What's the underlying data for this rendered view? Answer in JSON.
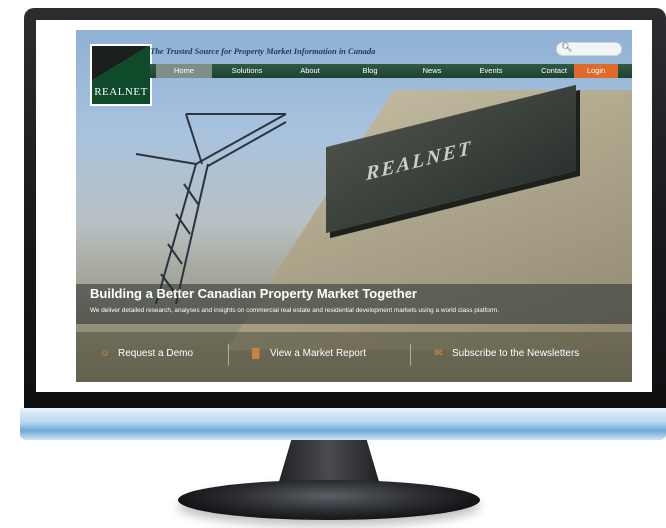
{
  "site": {
    "logo_text": "REALNET",
    "tagline": "The Trusted Source for Property Market Information in Canada",
    "nav": {
      "home": "Home",
      "solutions": "Solutions",
      "about": "About",
      "blog": "Blog",
      "news": "News",
      "events": "Events",
      "contact": "Contact",
      "login": "Login"
    },
    "search_icon": "search-icon",
    "building_sign": "REALNET",
    "hero": {
      "title": "Building a Better Canadian Property Market Together",
      "subtitle": "We deliver detailed research, analyses and insights on commercial real estate and residential development markets using a world class platform."
    },
    "cta": {
      "demo": "Request a Demo",
      "report": "View a Market Report",
      "newsletter": "Subscribe to the Newsletters"
    },
    "colors": {
      "nav_green": "#2f5a46",
      "login_orange": "#e06a2c",
      "logo_green": "#0f4a2b"
    }
  }
}
